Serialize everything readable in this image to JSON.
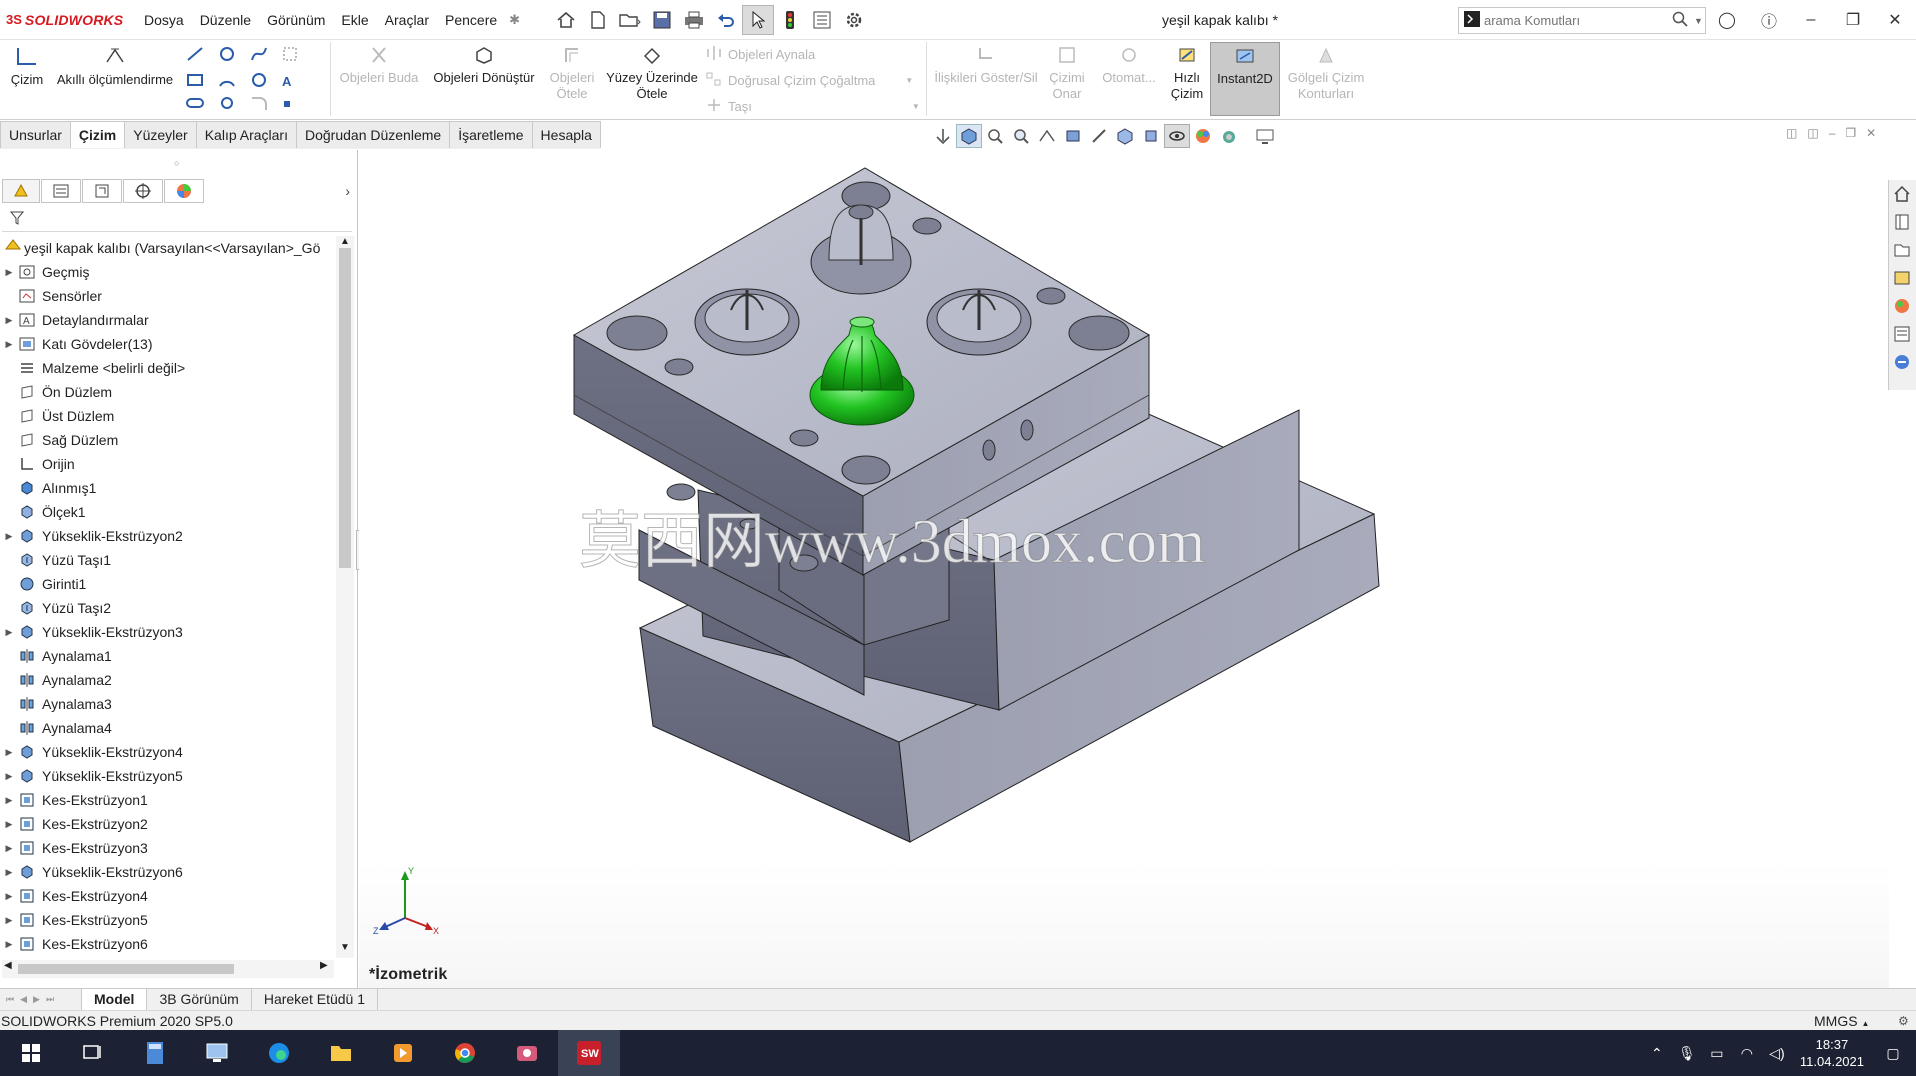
{
  "app": {
    "logo_ds": "3S",
    "logo_name": "SOLIDWORKS",
    "document_title": "yeşil kapak kalıbı *",
    "search_placeholder": "arama Komutları"
  },
  "menu": [
    "Dosya",
    "Düzenle",
    "Görünüm",
    "Ekle",
    "Araçlar",
    "Pencere"
  ],
  "command_manager": {
    "sketch": "Çizim",
    "smart_dimension": "Akıllı ölçümlendirme",
    "trim": "Objeleri Buda",
    "convert": "Objeleri Dönüştür",
    "offset_1": "Objeleri",
    "offset_2": "Ötele",
    "surface_offset_1": "Yüzey Üzerinde",
    "surface_offset_2": "Ötele",
    "mirror": "Objeleri Aynala",
    "linear_pattern": "Doğrusal Çizim Çoğaltma",
    "move": "Taşı",
    "relations": "İlişkileri Göster/Sil",
    "repair_1": "Çizimi",
    "repair_2": "Onar",
    "auto": "Otomat...",
    "quick_1": "Hızlı",
    "quick_2": "Çizim",
    "instant2d": "Instant2D",
    "shaded_1": "Gölgeli Çizim",
    "shaded_2": "Konturları"
  },
  "tabs": [
    "Unsurlar",
    "Çizim",
    "Yüzeyler",
    "Kalıp Araçları",
    "Doğrudan Düzenleme",
    "İşaretleme",
    "Hesapla"
  ],
  "active_tab": "Çizim",
  "tree": {
    "root": "yeşil kapak kalıbı  (Varsayılan<<Varsayılan>_Gö",
    "items": [
      {
        "label": "Geçmiş",
        "arrow": true,
        "icon": "history"
      },
      {
        "label": "Sensörler",
        "arrow": false,
        "icon": "sensor"
      },
      {
        "label": "Detaylandırmalar",
        "arrow": true,
        "icon": "annotation"
      },
      {
        "label": "Katı Gövdeler(13)",
        "arrow": true,
        "icon": "solid"
      },
      {
        "label": "Malzeme <belirli değil>",
        "arrow": false,
        "icon": "material"
      },
      {
        "label": "Ön Düzlem",
        "arrow": false,
        "icon": "plane"
      },
      {
        "label": "Üst Düzlem",
        "arrow": false,
        "icon": "plane"
      },
      {
        "label": "Sağ Düzlem",
        "arrow": false,
        "icon": "plane"
      },
      {
        "label": "Orijin",
        "arrow": false,
        "icon": "origin"
      },
      {
        "label": "Alınmış1",
        "arrow": false,
        "icon": "feature"
      },
      {
        "label": "Ölçek1",
        "arrow": false,
        "icon": "scale"
      },
      {
        "label": "Yükseklik-Ekstrüzyon2",
        "arrow": true,
        "icon": "extrude"
      },
      {
        "label": "Yüzü Taşı1",
        "arrow": false,
        "icon": "move"
      },
      {
        "label": "Girinti1",
        "arrow": false,
        "icon": "indent"
      },
      {
        "label": "Yüzü Taşı2",
        "arrow": false,
        "icon": "move"
      },
      {
        "label": "Yükseklik-Ekstrüzyon3",
        "arrow": true,
        "icon": "extrude"
      },
      {
        "label": "Aynalama1",
        "arrow": false,
        "icon": "mirror"
      },
      {
        "label": "Aynalama2",
        "arrow": false,
        "icon": "mirror"
      },
      {
        "label": "Aynalama3",
        "arrow": false,
        "icon": "mirror"
      },
      {
        "label": "Aynalama4",
        "arrow": false,
        "icon": "mirror"
      },
      {
        "label": "Yükseklik-Ekstrüzyon4",
        "arrow": true,
        "icon": "extrude"
      },
      {
        "label": "Yükseklik-Ekstrüzyon5",
        "arrow": true,
        "icon": "extrude"
      },
      {
        "label": "Kes-Ekstrüzyon1",
        "arrow": true,
        "icon": "cut"
      },
      {
        "label": "Kes-Ekstrüzyon2",
        "arrow": true,
        "icon": "cut"
      },
      {
        "label": "Kes-Ekstrüzyon3",
        "arrow": true,
        "icon": "cut"
      },
      {
        "label": "Yükseklik-Ekstrüzyon6",
        "arrow": true,
        "icon": "extrude"
      },
      {
        "label": "Kes-Ekstrüzyon4",
        "arrow": true,
        "icon": "cut"
      },
      {
        "label": "Kes-Ekstrüzyon5",
        "arrow": true,
        "icon": "cut"
      },
      {
        "label": "Kes-Ekstrüzyon6",
        "arrow": true,
        "icon": "cut"
      }
    ]
  },
  "viewport": {
    "view_name": "*İzometrik",
    "watermark": "莫西网www.3dmox.com",
    "part_color": "#b8bbca",
    "highlight_color": "#1fbf1f"
  },
  "bottom_tabs": [
    "Model",
    "3B Görünüm",
    "Hareket Etüdü 1"
  ],
  "status": {
    "left": "SOLIDWORKS Premium 2020 SP5.0",
    "units": "MMGS"
  },
  "taskbar": {
    "time": "18:37",
    "date": "11.04.2021"
  }
}
